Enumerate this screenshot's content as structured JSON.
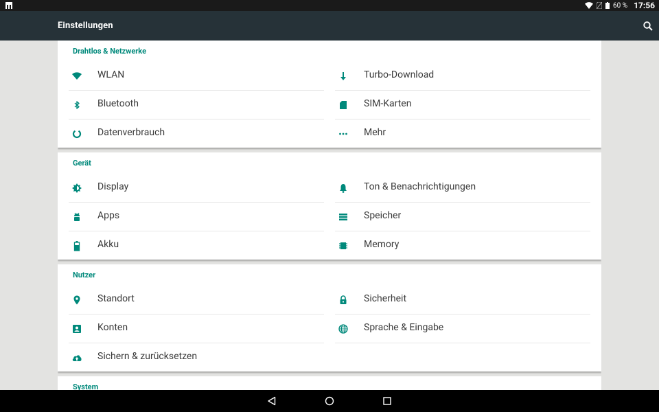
{
  "status_bar": {
    "battery": "60 %",
    "time": "17:56"
  },
  "toolbar": {
    "title": "Einstellungen"
  },
  "sections": [
    {
      "title": "Drahtlos & Netzwerke",
      "left": [
        {
          "label": "WLAN",
          "icon": "wifi-icon"
        },
        {
          "label": "Bluetooth",
          "icon": "bluetooth-icon"
        },
        {
          "label": "Datenverbrauch",
          "icon": "data-usage-icon"
        }
      ],
      "right": [
        {
          "label": "Turbo-Download",
          "icon": "download-arrow-icon"
        },
        {
          "label": "SIM-Karten",
          "icon": "sim-card-icon"
        },
        {
          "label": "Mehr",
          "icon": "more-dots-icon"
        }
      ]
    },
    {
      "title": "Gerät",
      "left": [
        {
          "label": "Display",
          "icon": "brightness-icon"
        },
        {
          "label": "Apps",
          "icon": "android-icon"
        },
        {
          "label": "Akku",
          "icon": "battery-icon"
        }
      ],
      "right": [
        {
          "label": "Ton & Benachrichtigungen",
          "icon": "bell-icon"
        },
        {
          "label": "Speicher",
          "icon": "storage-icon"
        },
        {
          "label": "Memory",
          "icon": "memory-chip-icon"
        }
      ]
    },
    {
      "title": "Nutzer",
      "left": [
        {
          "label": "Standort",
          "icon": "location-pin-icon"
        },
        {
          "label": "Konten",
          "icon": "account-box-icon"
        },
        {
          "label": "Sichern & zurücksetzen",
          "icon": "cloud-upload-icon"
        }
      ],
      "right": [
        {
          "label": "Sicherheit",
          "icon": "lock-icon"
        },
        {
          "label": "Sprache & Eingabe",
          "icon": "globe-icon"
        }
      ]
    },
    {
      "title": "System",
      "left": [],
      "right": []
    }
  ],
  "colors": {
    "accent": "#00897b",
    "toolbar": "#263238",
    "background": "#e3e3e1"
  }
}
